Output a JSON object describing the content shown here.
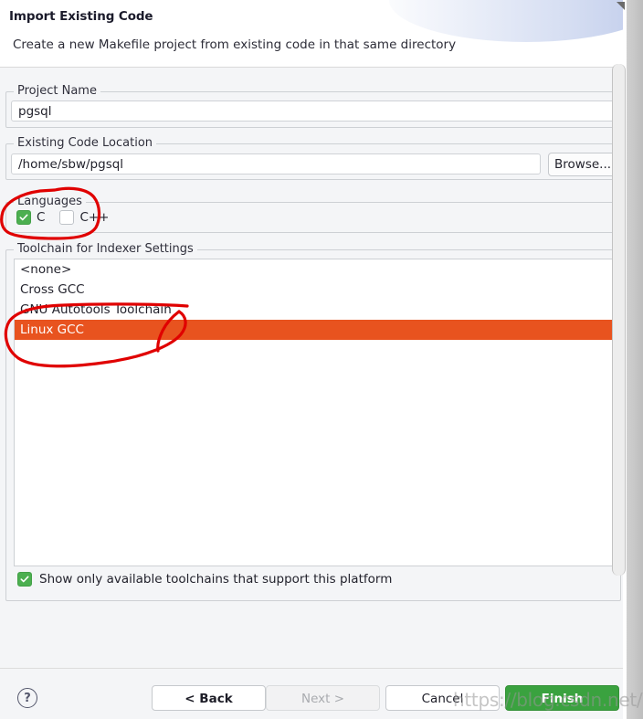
{
  "window": {
    "title": "Import Existing Code",
    "description": "Create a new Makefile project from existing code in that same directory"
  },
  "fields": {
    "project_name": {
      "label": "Project Name",
      "value": "pgsql",
      "placeholder": ""
    },
    "existing_code_location": {
      "label": "Existing Code Location",
      "value": "/home/sbw/pgsql",
      "placeholder": "",
      "browse_label": "Browse..."
    }
  },
  "languages": {
    "label": "Languages",
    "options": [
      {
        "label": "C",
        "checked": true
      },
      {
        "label": "C++",
        "checked": false
      }
    ]
  },
  "toolchain": {
    "label": "Toolchain for Indexer Settings",
    "items": [
      {
        "label": "<none>",
        "selected": false
      },
      {
        "label": "Cross GCC",
        "selected": false
      },
      {
        "label": "GNU Autotools Toolchain",
        "selected": false
      },
      {
        "label": "Linux GCC",
        "selected": true
      }
    ],
    "show_only_available": {
      "label": "Show only available toolchains that support this platform",
      "checked": true
    }
  },
  "buttons": {
    "help": "?",
    "back": "< Back",
    "next": "Next >",
    "cancel": "Cancel",
    "finish": "Finish"
  },
  "watermark": "https://blog.csdn.net/zxwsbg",
  "colors": {
    "selection": "#e8531f",
    "checkbox_checked": "#4caf50",
    "finish_button": "#3aa23f",
    "annotation": "#e00000"
  }
}
